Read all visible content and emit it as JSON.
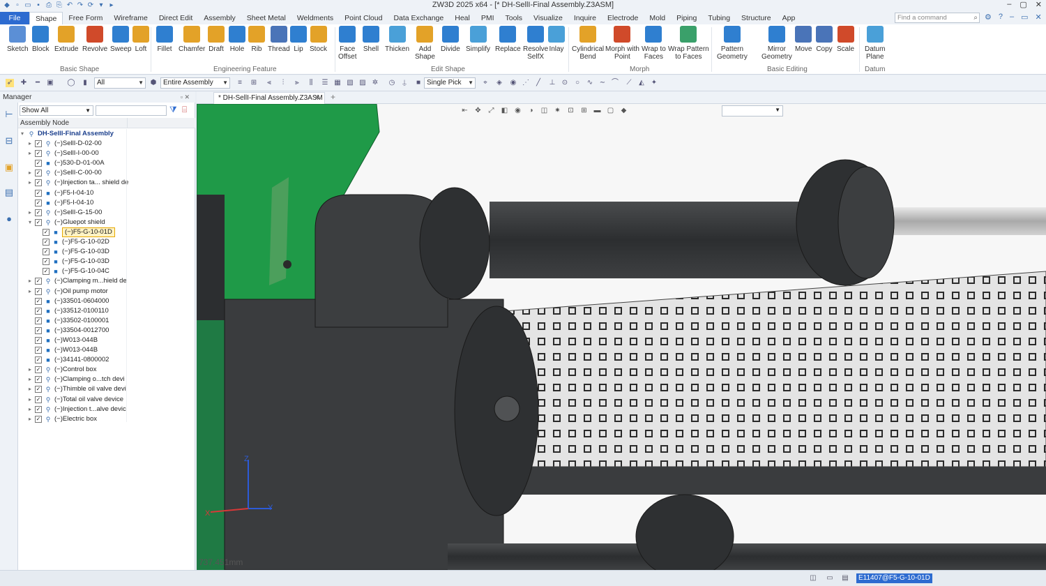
{
  "window": {
    "title": "ZW3D 2025 x64 - [* DH-SellI-Final Assembly.Z3ASM]",
    "min": "–",
    "max": "▢",
    "close": "✕"
  },
  "menu": {
    "file": "File",
    "tabs": [
      "Shape",
      "Free Form",
      "Wireframe",
      "Direct Edit",
      "Assembly",
      "Sheet Metal",
      "Weldments",
      "Point Cloud",
      "Data Exchange",
      "Heal",
      "PMI",
      "Tools",
      "Visualize",
      "Inquire",
      "Electrode",
      "Mold",
      "Piping",
      "Tubing",
      "Structure",
      "App"
    ],
    "active_tab": "Shape",
    "find_placeholder": "Find a command"
  },
  "ribbon": {
    "buttons": [
      {
        "label": "Sketch",
        "icon": "sketch-icon",
        "color": "#5b8fd6"
      },
      {
        "label": "Block",
        "icon": "block-icon",
        "color": "#2f7fd0"
      },
      {
        "label": "Extrude",
        "icon": "extrude-icon",
        "color": "#e3a228"
      },
      {
        "label": "Revolve",
        "icon": "revolve-icon",
        "color": "#d04a2a"
      },
      {
        "label": "Sweep",
        "icon": "sweep-icon",
        "color": "#2f7fd0"
      },
      {
        "label": "Loft",
        "icon": "loft-icon",
        "color": "#e3a228"
      },
      {
        "label": "Fillet",
        "icon": "fillet-icon",
        "color": "#2f7fd0"
      },
      {
        "label": "Chamfer",
        "icon": "chamfer-icon",
        "color": "#e3a228"
      },
      {
        "label": "Draft",
        "icon": "draft-icon",
        "color": "#e3a228"
      },
      {
        "label": "Hole",
        "icon": "hole-icon",
        "color": "#2f7fd0"
      },
      {
        "label": "Rib",
        "icon": "rib-icon",
        "color": "#e3a228"
      },
      {
        "label": "Thread",
        "icon": "thread-icon",
        "color": "#4a74b8"
      },
      {
        "label": "Lip",
        "icon": "lip-icon",
        "color": "#2f7fd0"
      },
      {
        "label": "Stock",
        "icon": "stock-icon",
        "color": "#e3a228"
      },
      {
        "label": "Face\nOffset",
        "icon": "face-offset-icon",
        "color": "#2f7fd0"
      },
      {
        "label": "Shell",
        "icon": "shell-icon",
        "color": "#2f7fd0"
      },
      {
        "label": "Thicken",
        "icon": "thicken-icon",
        "color": "#4aa0d8"
      },
      {
        "label": "Add\nShape",
        "icon": "add-shape-icon",
        "color": "#e3a228"
      },
      {
        "label": "Divide",
        "icon": "divide-icon",
        "color": "#2f7fd0"
      },
      {
        "label": "Simplify",
        "icon": "simplify-icon",
        "color": "#4aa0d8"
      },
      {
        "label": "Replace",
        "icon": "replace-icon",
        "color": "#2f7fd0"
      },
      {
        "label": "Resolve\nSelfX",
        "icon": "resolve-selfx-icon",
        "color": "#2f7fd0"
      },
      {
        "label": "Inlay",
        "icon": "inlay-icon",
        "color": "#4aa0d8"
      },
      {
        "label": "Cylindrical\nBend",
        "icon": "cylindrical-bend-icon",
        "color": "#e3a228"
      },
      {
        "label": "Morph with\nPoint",
        "icon": "morph-with-point-icon",
        "color": "#d04a2a"
      },
      {
        "label": "Wrap to\nFaces",
        "icon": "wrap-to-faces-icon",
        "color": "#2f7fd0"
      },
      {
        "label": "Wrap Pattern\nto Faces",
        "icon": "wrap-pattern-icon",
        "color": "#3aa06a"
      },
      {
        "label": "Pattern\nGeometry",
        "icon": "pattern-geometry-icon",
        "color": "#2f7fd0"
      },
      {
        "label": "Mirror\nGeometry",
        "icon": "mirror-geometry-icon",
        "color": "#2f7fd0"
      },
      {
        "label": "Move",
        "icon": "move-icon",
        "color": "#4a74b8"
      },
      {
        "label": "Copy",
        "icon": "copy-icon",
        "color": "#4a74b8"
      },
      {
        "label": "Scale",
        "icon": "scale-icon",
        "color": "#d04a2a"
      },
      {
        "label": "Datum\nPlane",
        "icon": "datum-plane-icon",
        "color": "#4aa0d8"
      }
    ],
    "groups": [
      "Basic Shape",
      "Engineering Feature",
      "Edit Shape",
      "Morph",
      "Basic Editing",
      "Datum"
    ]
  },
  "toolbar": {
    "filter": "All",
    "scope": "Entire Assembly",
    "pick": "Single Pick"
  },
  "manager": {
    "title": "Manager",
    "show": "Show All",
    "column": "Assembly Node",
    "tree": [
      {
        "label": "DH-SellI-Final Assembly",
        "level": 0,
        "expander": "▾",
        "icon": "assembly-icon",
        "root": true
      },
      {
        "label": "(−)SellI-D-02-00",
        "level": 1,
        "expander": "▸",
        "icon": "subassembly-icon"
      },
      {
        "label": "(−)SellI-I-00-00",
        "level": 1,
        "expander": "▸",
        "icon": "subassembly-icon"
      },
      {
        "label": "(−)530-D-01-00A",
        "level": 1,
        "expander": "",
        "icon": "part-icon"
      },
      {
        "label": "(−)SellI-C-00-00",
        "level": 1,
        "expander": "▸",
        "icon": "subassembly-icon"
      },
      {
        "label": "(−)Injection ta... shield de",
        "level": 1,
        "expander": "▸",
        "icon": "subassembly-icon"
      },
      {
        "label": "(−)F5-I-04-10",
        "level": 1,
        "expander": "",
        "icon": "part-icon"
      },
      {
        "label": "(−)F5-I-04-10",
        "level": 1,
        "expander": "",
        "icon": "part-icon"
      },
      {
        "label": "(−)SellI-G-15-00",
        "level": 1,
        "expander": "▸",
        "icon": "subassembly-icon"
      },
      {
        "label": "(−)Gluepot shield",
        "level": 1,
        "expander": "▾",
        "icon": "subassembly-icon"
      },
      {
        "label": "(−)F5-G-10-01D",
        "level": 2,
        "expander": "",
        "icon": "part-icon",
        "selected": true
      },
      {
        "label": "(−)F5-G-10-02D",
        "level": 2,
        "expander": "",
        "icon": "part-icon"
      },
      {
        "label": "(−)F5-G-10-03D",
        "level": 2,
        "expander": "",
        "icon": "part-icon"
      },
      {
        "label": "(−)F5-G-10-03D",
        "level": 2,
        "expander": "",
        "icon": "part-icon"
      },
      {
        "label": "(−)F5-G-10-04C",
        "level": 2,
        "expander": "",
        "icon": "part-icon"
      },
      {
        "label": "(−)Clamping m...hield de",
        "level": 1,
        "expander": "▸",
        "icon": "subassembly-icon"
      },
      {
        "label": "(−)Oil pump motor",
        "level": 1,
        "expander": "▸",
        "icon": "subassembly-icon"
      },
      {
        "label": "(−)33501-0604000",
        "level": 1,
        "expander": "",
        "icon": "part-icon"
      },
      {
        "label": "(−)33512-0100110",
        "level": 1,
        "expander": "",
        "icon": "part-icon"
      },
      {
        "label": "(−)33502-0100001",
        "level": 1,
        "expander": "",
        "icon": "part-icon"
      },
      {
        "label": "(−)33504-0012700",
        "level": 1,
        "expander": "",
        "icon": "part-icon"
      },
      {
        "label": "(−)W013-044B",
        "level": 1,
        "expander": "",
        "icon": "part-icon"
      },
      {
        "label": "(−)W013-044B",
        "level": 1,
        "expander": "",
        "icon": "part-icon"
      },
      {
        "label": "(−)34141-0800002",
        "level": 1,
        "expander": "",
        "icon": "part-icon"
      },
      {
        "label": "(−)Control box",
        "level": 1,
        "expander": "▸",
        "icon": "subassembly-icon"
      },
      {
        "label": "(−)Clamping o...tch devi",
        "level": 1,
        "expander": "▸",
        "icon": "subassembly-icon"
      },
      {
        "label": "(−)Thimble oil valve devi",
        "level": 1,
        "expander": "▸",
        "icon": "subassembly-icon"
      },
      {
        "label": "(−)Total oil valve device",
        "level": 1,
        "expander": "▸",
        "icon": "subassembly-icon"
      },
      {
        "label": "(−)Injection t...alve devic",
        "level": 1,
        "expander": "▸",
        "icon": "subassembly-icon"
      },
      {
        "label": "(−)Electric box",
        "level": 1,
        "expander": "▸",
        "icon": "subassembly-icon"
      }
    ]
  },
  "doc": {
    "tab": "* DH-SellI-Final Assembly.Z3ASM",
    "close": "✕",
    "plus": "+"
  },
  "viewport": {
    "scale": "737.451mm",
    "axes": {
      "z": "Z",
      "y": "Y",
      "x": "X"
    },
    "colors": {
      "green": "#1f9a48",
      "dark": "#3a3c3e",
      "background": "#f7f7f7"
    }
  },
  "status": {
    "selection": "E11407@F5-G-10-01D"
  }
}
